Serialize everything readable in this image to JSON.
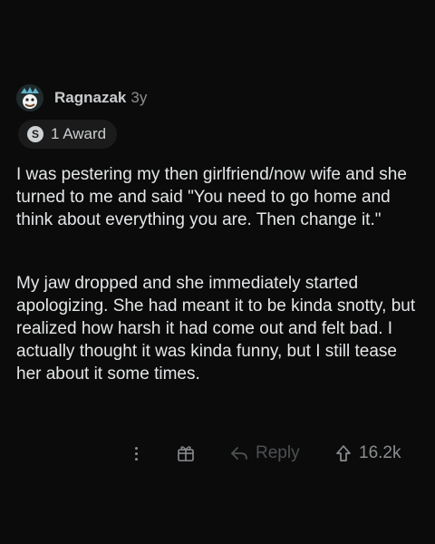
{
  "comment": {
    "author": "Ragnazak",
    "age": "3y",
    "award_symbol": "S",
    "awards_label": "1 Award",
    "paragraphs": [
      "I was pestering my then girlfriend/now wife and she turned to me and said \"You need to go home and think about everything you are. Then change it.\"",
      "My jaw dropped and she immediately started apologizing. She had meant it to be kinda snotty, but realized how harsh it had come out and felt bad. I actually thought it was kinda funny, but I still tease her about it some times."
    ]
  },
  "actions": {
    "more_icon": "more-vertical-icon",
    "gift_icon": "gift-icon",
    "reply_icon": "reply-arrow-icon",
    "reply_label": "Reply",
    "upvote_icon": "upvote-arrow-icon",
    "score": "16.2k"
  },
  "colors": {
    "background": "#0b0b0b",
    "text": "#e4e6e8",
    "muted": "#8a8d8f",
    "disabled": "#4d5052",
    "pill": "#1b1b1b"
  }
}
